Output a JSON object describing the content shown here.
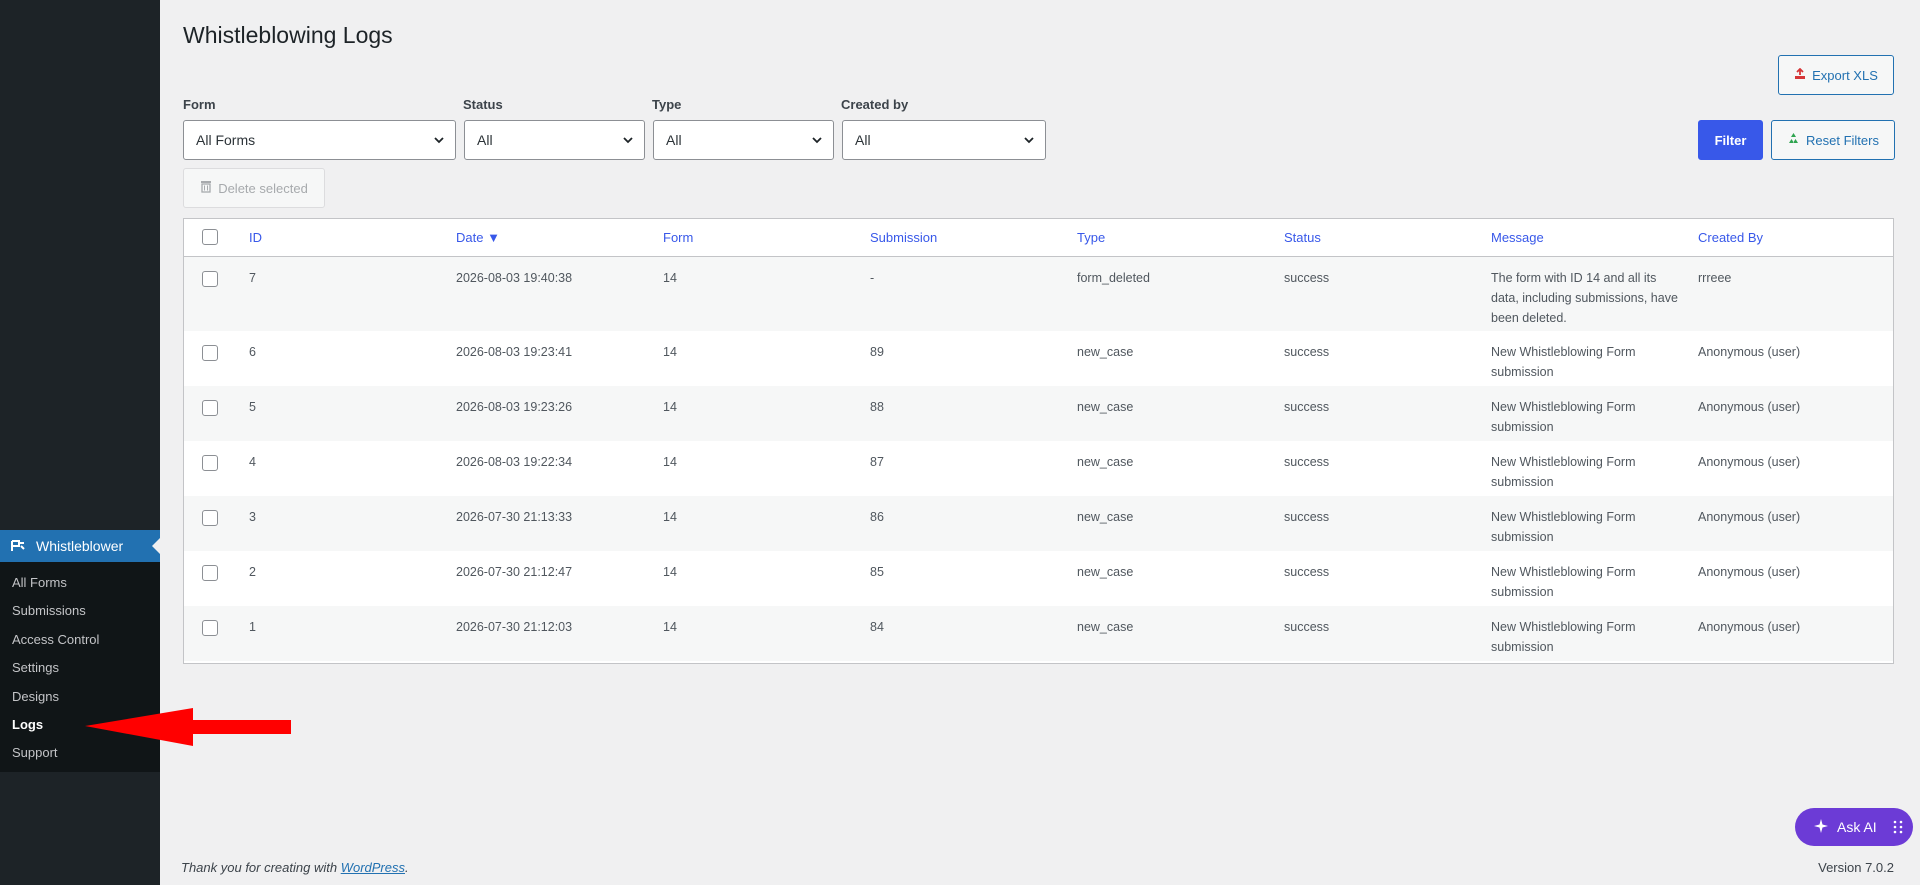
{
  "sidebar": {
    "current_menu": "Whistleblower",
    "items": [
      {
        "label": "All Forms"
      },
      {
        "label": "Submissions"
      },
      {
        "label": "Access Control"
      },
      {
        "label": "Settings"
      },
      {
        "label": "Designs"
      },
      {
        "label": "Logs"
      },
      {
        "label": "Support"
      }
    ]
  },
  "page": {
    "title": "Whistleblowing Logs"
  },
  "filters": {
    "form_label": "Form",
    "form_value": "All Forms",
    "status_label": "Status",
    "status_value": "All",
    "type_label": "Type",
    "type_value": "All",
    "created_by_label": "Created by",
    "created_by_value": "All"
  },
  "buttons": {
    "export": "Export XLS",
    "filter": "Filter",
    "reset": "Reset Filters",
    "delete_selected": "Delete selected"
  },
  "table": {
    "columns": [
      "ID",
      "Date ▼",
      "Form",
      "Submission",
      "Type",
      "Status",
      "Message",
      "Created By"
    ],
    "rows": [
      {
        "id": "7",
        "date": "2026-08-03 19:40:38",
        "form": "14",
        "submission": "-",
        "type": "form_deleted",
        "status": "success",
        "message": "The form with ID 14 and all its data, including submissions, have been deleted.",
        "created_by": "rrreee"
      },
      {
        "id": "6",
        "date": "2026-08-03 19:23:41",
        "form": "14",
        "submission": "89",
        "type": "new_case",
        "status": "success",
        "message": "New Whistleblowing Form submission",
        "created_by": "Anonymous (user)"
      },
      {
        "id": "5",
        "date": "2026-08-03 19:23:26",
        "form": "14",
        "submission": "88",
        "type": "new_case",
        "status": "success",
        "message": "New Whistleblowing Form submission",
        "created_by": "Anonymous (user)"
      },
      {
        "id": "4",
        "date": "2026-08-03 19:22:34",
        "form": "14",
        "submission": "87",
        "type": "new_case",
        "status": "success",
        "message": "New Whistleblowing Form submission",
        "created_by": "Anonymous (user)"
      },
      {
        "id": "3",
        "date": "2026-07-30 21:13:33",
        "form": "14",
        "submission": "86",
        "type": "new_case",
        "status": "success",
        "message": "New Whistleblowing Form submission",
        "created_by": "Anonymous (user)"
      },
      {
        "id": "2",
        "date": "2026-07-30 21:12:47",
        "form": "14",
        "submission": "85",
        "type": "new_case",
        "status": "success",
        "message": "New Whistleblowing Form submission",
        "created_by": "Anonymous (user)"
      },
      {
        "id": "1",
        "date": "2026-07-30 21:12:03",
        "form": "14",
        "submission": "84",
        "type": "new_case",
        "status": "success",
        "message": "New Whistleblowing Form submission",
        "created_by": "Anonymous (user)"
      }
    ]
  },
  "footer": {
    "thanks_prefix": "Thank you for creating with ",
    "thanks_link": "WordPress",
    "thanks_suffix": ".",
    "version": "Version 7.0.2"
  },
  "ask_ai": {
    "label": "Ask AI"
  },
  "colors": {
    "accent": "#3858e9",
    "sidebar_bg": "#1d2327",
    "annotation_arrow": "#ff0000"
  },
  "icons": {
    "menu_icon": "whistleblower-icon",
    "export_icon": "export-icon",
    "reset_icon": "recycle-icon",
    "delete_icon": "trash-icon",
    "ask_ai_icon": "sparkle-icon"
  }
}
